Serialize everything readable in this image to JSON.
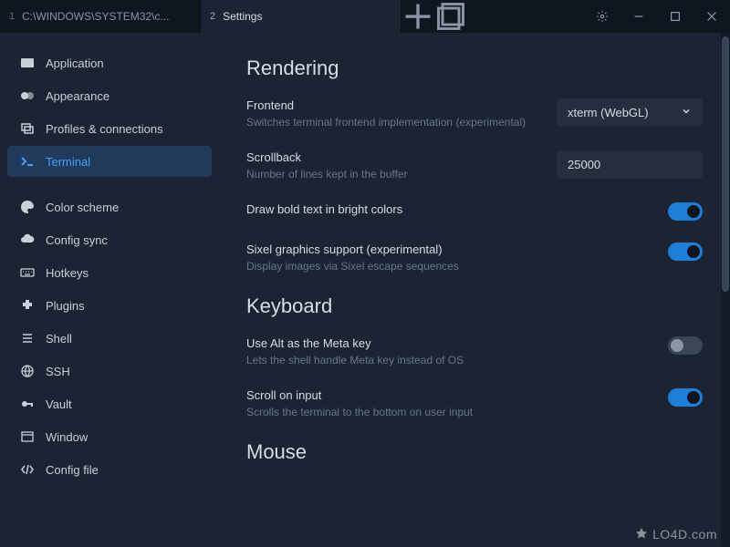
{
  "tabs": [
    {
      "num": "1",
      "title": "C:\\WINDOWS\\SYSTEM32\\c..."
    },
    {
      "num": "2",
      "title": "Settings"
    }
  ],
  "sidebar": {
    "items": [
      {
        "label": "Application"
      },
      {
        "label": "Appearance"
      },
      {
        "label": "Profiles & connections"
      },
      {
        "label": "Terminal"
      },
      {
        "label": "Color scheme"
      },
      {
        "label": "Config sync"
      },
      {
        "label": "Hotkeys"
      },
      {
        "label": "Plugins"
      },
      {
        "label": "Shell"
      },
      {
        "label": "SSH"
      },
      {
        "label": "Vault"
      },
      {
        "label": "Window"
      },
      {
        "label": "Config file"
      }
    ]
  },
  "content": {
    "sections": {
      "rendering": {
        "title": "Rendering",
        "frontend": {
          "label": "Frontend",
          "desc": "Switches terminal frontend implementation (experimental)",
          "value": "xterm (WebGL)"
        },
        "scrollback": {
          "label": "Scrollback",
          "desc": "Number of lines kept in the buffer",
          "value": "25000"
        },
        "bold_bright": {
          "label": "Draw bold text in bright colors",
          "on": true
        },
        "sixel": {
          "label": "Sixel graphics support (experimental)",
          "desc": "Display images via Sixel escape sequences",
          "on": true
        }
      },
      "keyboard": {
        "title": "Keyboard",
        "alt_meta": {
          "label": "Use Alt as the Meta key",
          "desc": "Lets the shell handle Meta key instead of OS",
          "on": false
        },
        "scroll_input": {
          "label": "Scroll on input",
          "desc": "Scrolls the terminal to the bottom on user input",
          "on": true
        }
      },
      "mouse": {
        "title": "Mouse"
      }
    }
  },
  "watermark": "LO4D.com"
}
